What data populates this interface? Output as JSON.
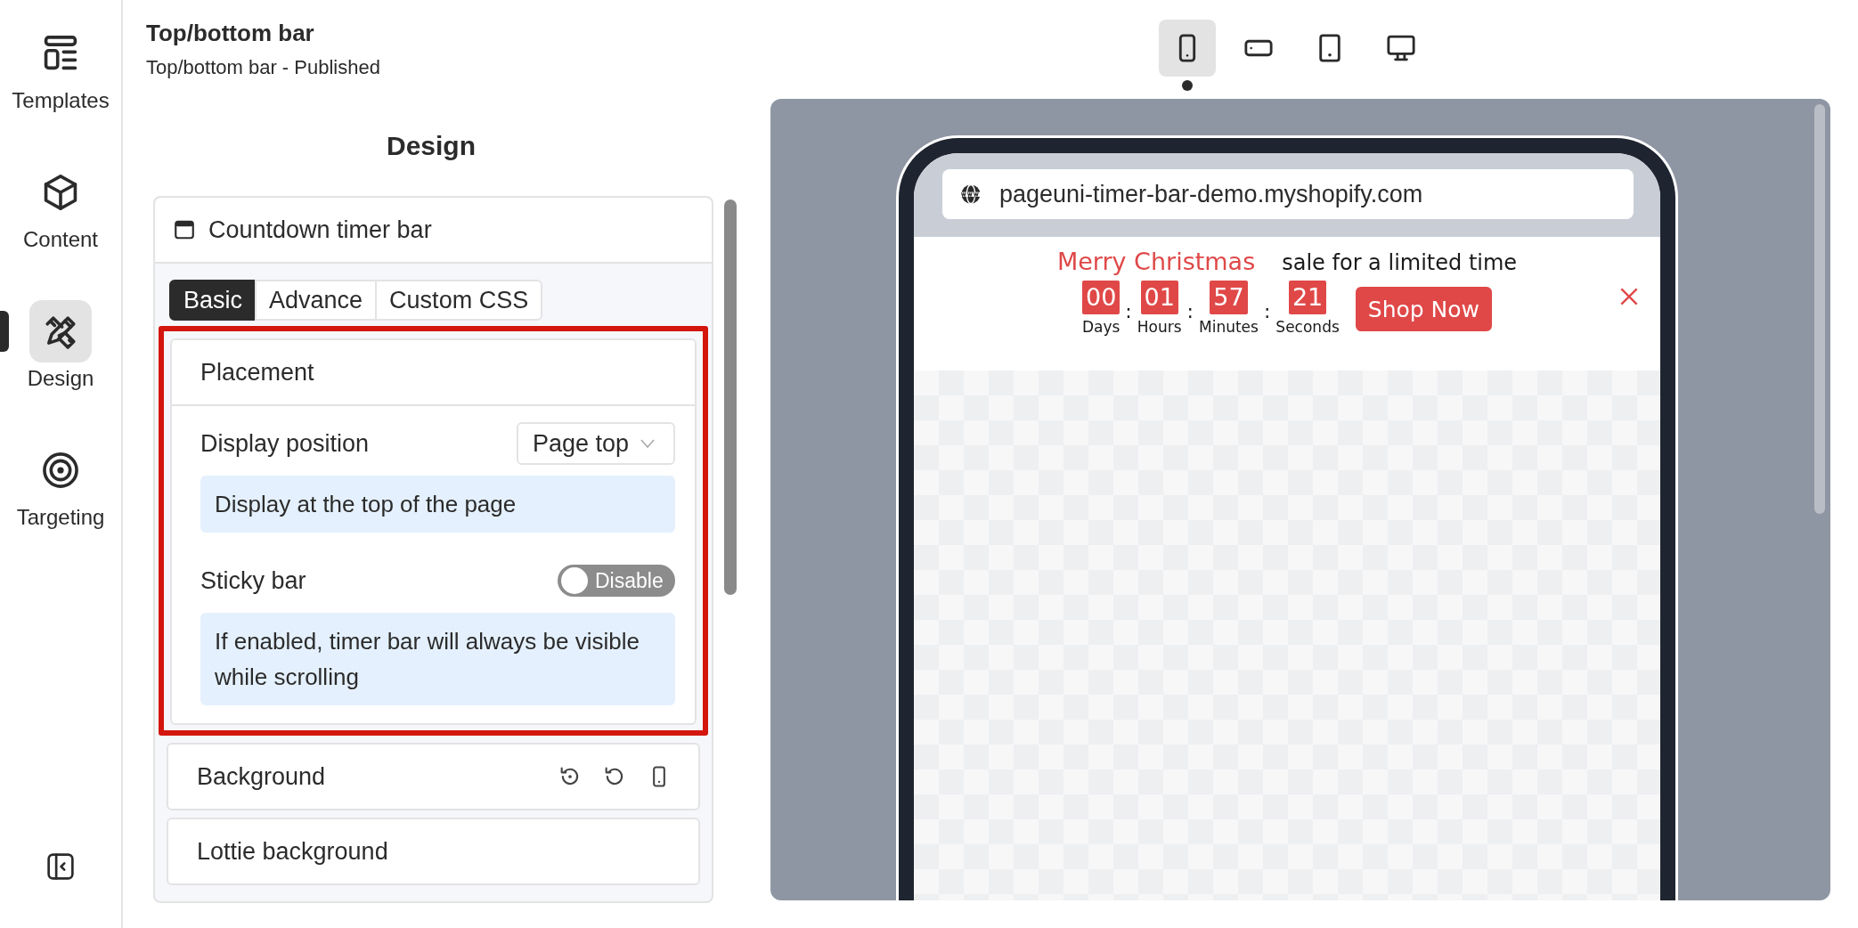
{
  "nav": {
    "items": [
      {
        "kind": "templates",
        "label": "Templates",
        "selected": false
      },
      {
        "kind": "content",
        "label": "Content",
        "selected": false
      },
      {
        "kind": "design",
        "label": "Design",
        "selected": true
      },
      {
        "kind": "targeting",
        "label": "Targeting",
        "selected": false
      }
    ]
  },
  "header": {
    "title": "Top/bottom bar",
    "subtitle": "Top/bottom bar - Published"
  },
  "panel": {
    "heading": "Design",
    "card": {
      "title": "Countdown timer bar",
      "tabs": [
        {
          "label": "Basic",
          "selected": true
        },
        {
          "label": "Advance",
          "selected": false
        },
        {
          "label": "Custom CSS",
          "selected": false
        }
      ],
      "sections": [
        {
          "title": "Placement",
          "expanded": true,
          "highlighted": true,
          "fields": [
            {
              "kind": "select",
              "label": "Display position",
              "value": "Page top",
              "hint": "Display at the top of the page"
            },
            {
              "kind": "toggle",
              "label": "Sticky bar",
              "on": false,
              "state_label": "Disable",
              "hint": "If enabled, timer bar will always be visible while scrolling"
            }
          ]
        },
        {
          "title": "Background",
          "expanded": false,
          "highlighted": false,
          "show_actions": true
        },
        {
          "title": "Lottie background",
          "expanded": false,
          "highlighted": false
        }
      ]
    }
  },
  "devices": [
    {
      "kind": "phone",
      "selected": true
    },
    {
      "kind": "phone-landscape",
      "selected": false
    },
    {
      "kind": "tablet",
      "selected": false
    },
    {
      "kind": "desktop",
      "selected": false
    }
  ],
  "preview": {
    "url": "pageuni-timer-bar-demo.myshopify.com",
    "bar": {
      "headline": "Merry Christmas",
      "text": "sale for a limited time",
      "timer": [
        {
          "value": "00",
          "unit": "Days",
          "separator": ":"
        },
        {
          "value": "01",
          "unit": "Hours",
          "separator": ":"
        },
        {
          "value": "57",
          "unit": "Minutes",
          "separator": ":"
        },
        {
          "value": "21",
          "unit": "Seconds"
        }
      ],
      "button": "Shop Now"
    }
  }
}
